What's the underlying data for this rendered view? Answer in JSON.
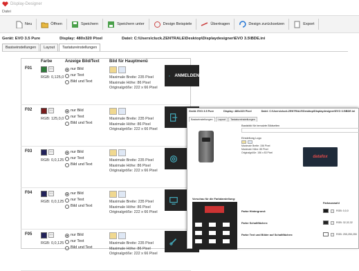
{
  "app": {
    "title": "Display-Designer",
    "menu": "Datei"
  },
  "toolbar": [
    {
      "label": "Neu",
      "icon": "new-file-icon"
    },
    {
      "label": "Öffnen",
      "icon": "folder-icon"
    },
    {
      "label": "Speichern",
      "icon": "save-icon"
    },
    {
      "label": "Speichern unter",
      "icon": "save-as-icon"
    },
    {
      "label": "Design Beispiele",
      "icon": "examples-icon"
    },
    {
      "label": "Übertragen",
      "icon": "transfer-icon"
    },
    {
      "label": "Design zurücksetzen",
      "icon": "reset-icon"
    },
    {
      "label": "Export",
      "icon": "export-icon"
    }
  ],
  "info": {
    "device_label": "Gerät:",
    "device": "EVO 3.5 Pure",
    "display_label": "Display:",
    "display": "480x320 Pixel",
    "file_label": "Datei:",
    "file": "C:\\Users\\cluck.ZENTRALE\\Desktop\\Displaydesigner\\EVO 3.5\\BDE.ini"
  },
  "tabs": [
    "Basiseinstellungen",
    "Layout",
    "Tastatureinstellungen"
  ],
  "columns": {
    "farbe": "Farbe",
    "anzeige": "Anzeige Bild/Text",
    "bild": "Bild für Hauptmenü"
  },
  "radio_labels": [
    "nur Bild",
    "nur Text",
    "Bild und Text"
  ],
  "dims_labels": {
    "breite": "Maximale Breite:",
    "hoehe": "Maximale Höhe:",
    "unit": "Pixel",
    "orig": "Originalgröße:"
  },
  "rows": [
    {
      "code": "F01",
      "color": "#2e7d3a",
      "rgb": "RGB: 0,125,0",
      "selected": 0,
      "max_w": "235",
      "max_h": "86",
      "orig": "222 x 66 Pixel",
      "preview_text": "ANMELDEN",
      "icon": "login-icon"
    },
    {
      "code": "F02",
      "color": "#7a1d1d",
      "rgb": "RGB: 125,0,0",
      "selected": 0,
      "max_w": "235",
      "max_h": "86",
      "orig": "222 x 66 Pixel",
      "preview_text": "",
      "icon": "logout-icon"
    },
    {
      "code": "F03",
      "color": "#22225a",
      "rgb": "RGB: 0,0,125",
      "selected": 0,
      "max_w": "235",
      "max_h": "86",
      "orig": "222 x 66 Pixel",
      "preview_text": "",
      "icon": "settings-icon"
    },
    {
      "code": "F04",
      "color": "#22225a",
      "rgb": "RGB: 0,0,125",
      "selected": 0,
      "max_w": "235",
      "max_h": "86",
      "orig": "222 x 66 Pixel",
      "preview_text": "",
      "icon": "monitor-icon"
    },
    {
      "code": "F05",
      "color": "#22225a",
      "rgb": "RGB: 0,0,125",
      "selected": 0,
      "max_w": "235",
      "max_h": "86",
      "orig": "222 x 66 Pixel",
      "preview_text": "",
      "icon": "link-icon"
    }
  ],
  "overlay": {
    "device": "Gerät: EVO 3.5 Pure",
    "display": "Display: 480x320 Pixel",
    "file": "Datei: C:\\Users\\cluck.ZENTRALE\\Desktop\\Displaydesigner\\EVO 3.5\\BDE.ini",
    "tabs": [
      "Basiseinstellungen",
      "Layout",
      "Tastatureinstellungen"
    ],
    "bg_label": "Basisbild für benutzte Bildseiten",
    "logo_label": "Einstellung Logo",
    "logo_dims": [
      "Maximale Breite: 156   Pixel",
      "Maximale Höhe: 85   Pixel",
      "Originalgröße: 156 x 83   Pixel"
    ],
    "logo_text": "datafox",
    "preview_label": "Vorschau für die Farbdarstellung:",
    "farbauswahl": "Farbauswahl",
    "color_rows": [
      {
        "label": "Farbe Hintergrund:",
        "color": "#1a1a1a",
        "rgb": "RGB: 0,0,0"
      },
      {
        "label": "Farbe Schaltflächen:",
        "color": "#222222",
        "rgb": "RGB: 32,32,32"
      },
      {
        "label": "Farbe Text und Bilder auf Schaltflächen:",
        "color": "#ffffff",
        "rgb": "RGB: 255,255,255"
      }
    ]
  }
}
